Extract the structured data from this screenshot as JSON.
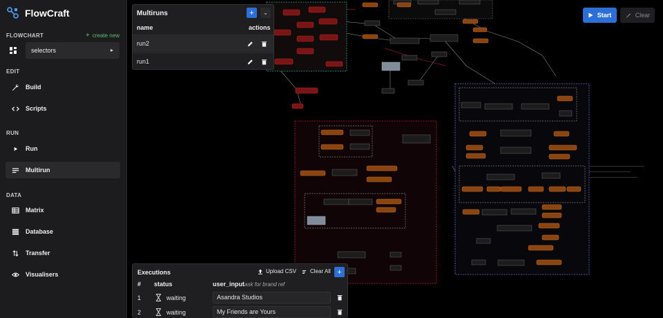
{
  "app": {
    "name": "FlowCraft"
  },
  "sidebar": {
    "flowchart_label": "FLOWCHART",
    "create_new_label": "create new",
    "selected_flowchart": "selectors",
    "edit_label": "EDIT",
    "build_label": "Build",
    "scripts_label": "Scripts",
    "run_label": "RUN",
    "run_item_label": "Run",
    "multirun_label": "Multirun",
    "data_label": "DATA",
    "matrix_label": "Matrix",
    "database_label": "Database",
    "transfer_label": "Transfer",
    "visualisers_label": "Visualisers"
  },
  "multiruns": {
    "title": "Multiruns",
    "col_name": "name",
    "col_actions": "actions",
    "rows": [
      {
        "name": "run2"
      },
      {
        "name": "run1"
      }
    ]
  },
  "executions": {
    "title": "Executions",
    "upload_label": "Upload CSV",
    "clear_all_label": "Clear All",
    "col_num": "#",
    "col_status": "status",
    "col_input": "user_input",
    "input_hint": "ask for brand ref",
    "rows": [
      {
        "num": "1",
        "status": "waiting",
        "input": "Asandra Studios"
      },
      {
        "num": "2",
        "status": "waiting",
        "input": "My Friends are Yours"
      }
    ]
  },
  "toolbar": {
    "start_label": "Start",
    "clear_label": "Clear"
  },
  "colors": {
    "accent": "#2c6fd6",
    "green": "#5fbf6a",
    "node_red": "#8b1c1c",
    "node_orange": "#c0621a",
    "group_blue": "#6b6bd9"
  }
}
